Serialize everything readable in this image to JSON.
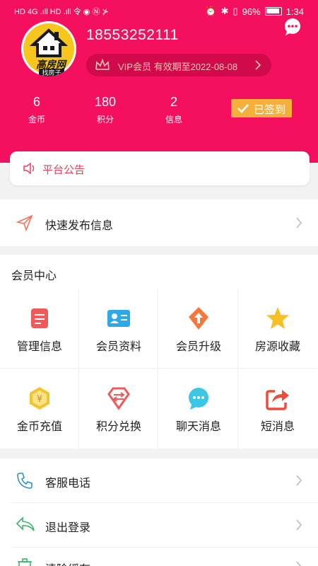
{
  "statusbar": {
    "left": "HD 4G .ıll HD .ıll 令 ◉ Ⓝ ⊁",
    "battery": "96%",
    "time": "1:34"
  },
  "profile": {
    "logo_text": "高房网",
    "logo_sub": "找房子",
    "phone": "18553252111",
    "vip_text": "VIP会员 有效期至2022-08-08"
  },
  "stats": [
    {
      "value": "6",
      "label": "金币"
    },
    {
      "value": "180",
      "label": "积分"
    },
    {
      "value": "2",
      "label": "信息"
    }
  ],
  "checkin_label": "已签到",
  "notice_label": "平台公告",
  "quick_publish_label": "快速发布信息",
  "member_center": {
    "title": "会员中心",
    "items": [
      {
        "label": "管理信息",
        "icon": "manage-info-icon",
        "color": "#f05a5a"
      },
      {
        "label": "会员资料",
        "icon": "member-profile-icon",
        "color": "#2fa8e6"
      },
      {
        "label": "会员升级",
        "icon": "upgrade-icon",
        "color": "#f4783b"
      },
      {
        "label": "房源收藏",
        "icon": "star-icon",
        "color": "#f6c022"
      },
      {
        "label": "金币充值",
        "icon": "coin-recharge-icon",
        "color": "#f2c530"
      },
      {
        "label": "积分兑换",
        "icon": "points-exchange-icon",
        "color": "#ee5a5a"
      },
      {
        "label": "聊天消息",
        "icon": "chat-icon",
        "color": "#3cc6e6"
      },
      {
        "label": "短消息",
        "icon": "share-message-icon",
        "color": "#ef4b3c"
      }
    ]
  },
  "menu": [
    {
      "label": "客服电话",
      "icon": "phone-icon"
    },
    {
      "label": "退出登录",
      "icon": "logout-icon"
    },
    {
      "label": "清除缓存",
      "icon": "trash-icon"
    }
  ],
  "colors": {
    "brand": "#f4105f",
    "checkin": "#f5b03b"
  }
}
